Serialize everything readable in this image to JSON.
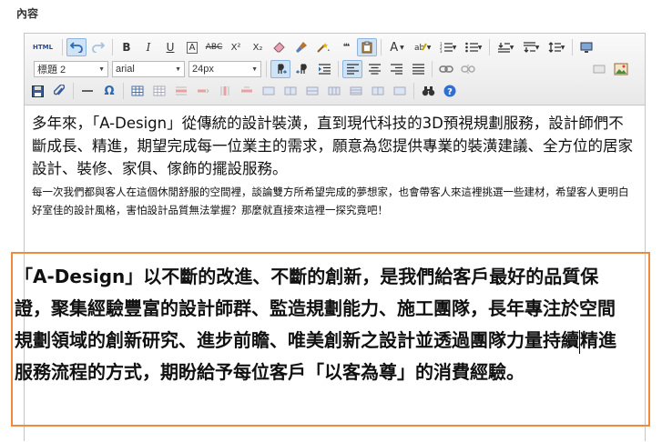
{
  "field_label": "內容",
  "toolbar": {
    "source_label": "HTML",
    "bold": "B",
    "italic": "I",
    "underline": "U",
    "removeformat": "A",
    "strike": "ABC",
    "superscript": "X²",
    "subscript": "X₂",
    "blockquote": "❝❝",
    "fontcolor": "A",
    "format_value": "標題 2",
    "fontfamily_value": "arial",
    "fontsize_value": "24px",
    "special_char": "Ω"
  },
  "content": {
    "para1": "多年來，「A-Design」從傳統的設計裝潢，直到現代科技的3D預視規劃服務，設計師們不斷成長、精進，期望完成每一位業主的需求，願意為您提供專業的裝潢建議、全方位的居家設計、裝修、家俱、傢飾的擺設服務。",
    "para2": "每一次我們都與客人在這個休閒舒服的空間裡，談論雙方所希望完成的夢想家，也會帶客人來這裡挑選一些建材，希望客人更明白好室佳的設計風格，害怕設計品質無法掌握？那麼就直接來這裡一探究竟吧！",
    "para3_before_cursor": "「A-Design」以不斷的改進、不斷的創新，是我們給客戶最好的品質保證，聚集經驗豐富的設計師群、監造規劃能力、施工團隊，長年專注於空間規劃領域的創新研究、進步前瞻、唯美創新之設計並透過團隊力量持續",
    "para3_after_cursor": "精進服務流程的方式，期盼給予每位客戶「以客為尊」的消費經驗。"
  },
  "colors": {
    "highlight_border": "#f08a3c",
    "active_button": "#cfe3f7"
  }
}
